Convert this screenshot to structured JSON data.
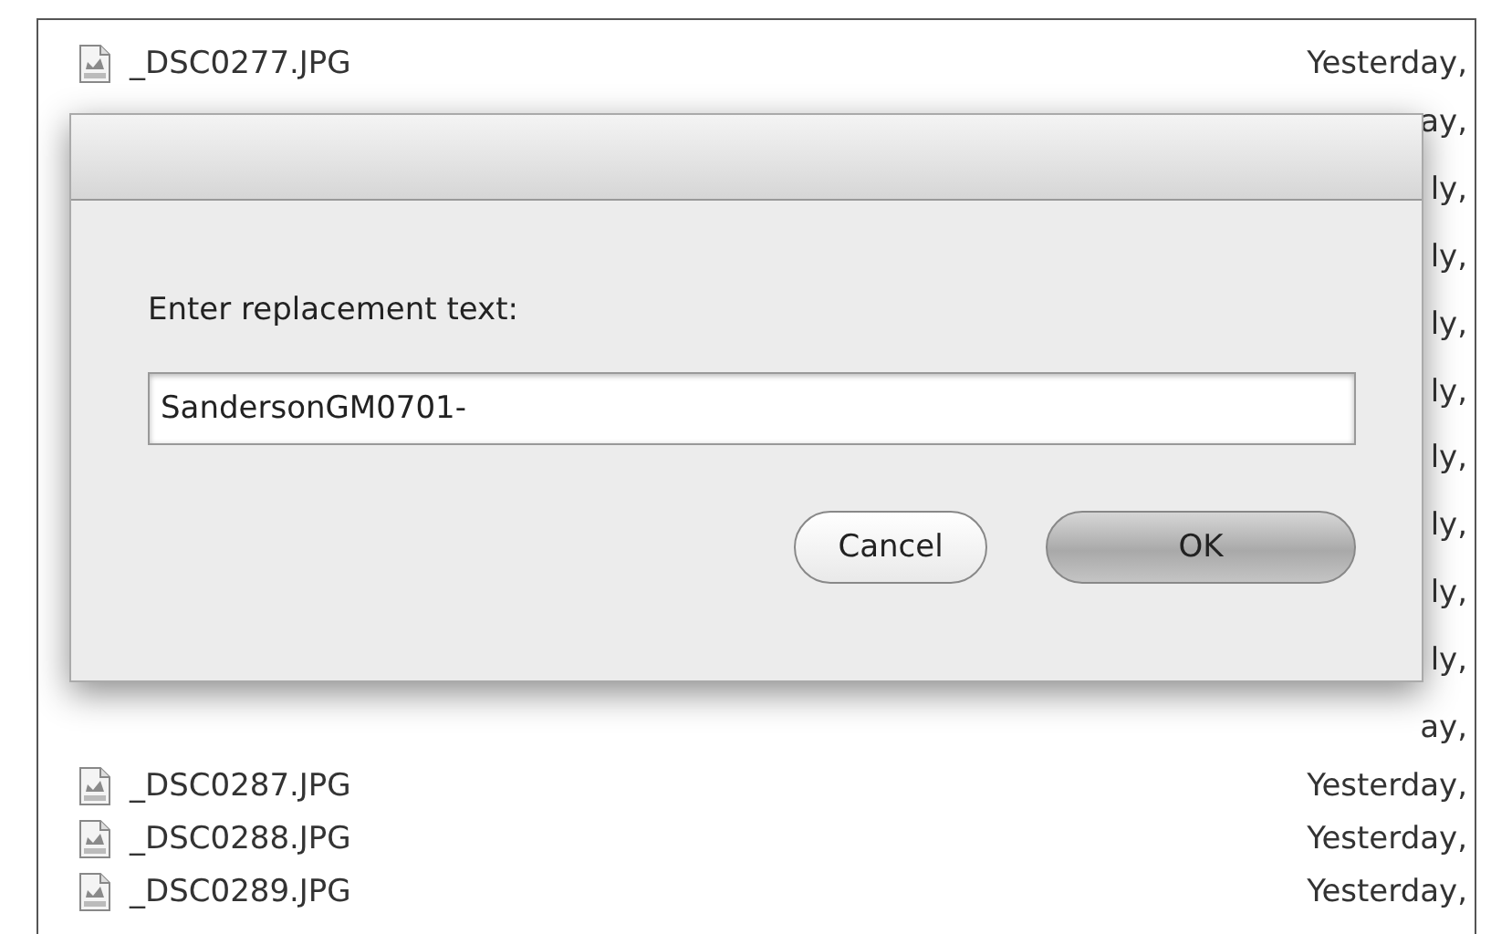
{
  "files": [
    {
      "kind": "file",
      "name": "_DSC0277.JPG",
      "date": "Yesterday,"
    },
    {
      "kind": "covered",
      "date": "ay,"
    },
    {
      "kind": "covered",
      "date": "ly,"
    },
    {
      "kind": "covered",
      "date": "ly,"
    },
    {
      "kind": "covered",
      "date": "ly,"
    },
    {
      "kind": "covered",
      "date": "ly,"
    },
    {
      "kind": "covered",
      "date": "ly,"
    },
    {
      "kind": "covered",
      "date": "ly,"
    },
    {
      "kind": "covered",
      "date": "ly,"
    },
    {
      "kind": "covered",
      "date": "ly,"
    },
    {
      "kind": "covered",
      "date": "ay,"
    },
    {
      "kind": "file",
      "name": "_DSC0287.JPG",
      "date": "Yesterday,"
    },
    {
      "kind": "file",
      "name": "_DSC0288.JPG",
      "date": "Yesterday,"
    },
    {
      "kind": "file",
      "name": "_DSC0289.JPG",
      "date": "Yesterday,"
    }
  ],
  "dialog": {
    "label": "Enter replacement text:",
    "value": "SandersonGM0701-",
    "buttons": [
      {
        "label": "Cancel",
        "default": false
      },
      {
        "label": "OK",
        "default": true
      }
    ]
  }
}
